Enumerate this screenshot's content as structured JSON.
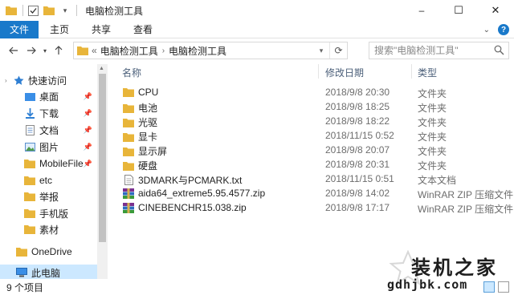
{
  "window": {
    "title": "电脑检测工具",
    "minimize_glyph": "–",
    "maximize_glyph": "☐",
    "close_glyph": "✕"
  },
  "ribbon": {
    "tabs": [
      "文件",
      "主页",
      "共享",
      "查看"
    ]
  },
  "address": {
    "segments": [
      "电脑检测工具",
      "电脑检测工具"
    ],
    "prefix": "«"
  },
  "search": {
    "placeholder": "搜索\"电脑检测工具\""
  },
  "nav": {
    "items": [
      {
        "label": "快速访问",
        "icon": "star-icon",
        "pinned": false,
        "indent": 0
      },
      {
        "label": "桌面",
        "icon": "desktop-folder-icon",
        "pinned": true,
        "indent": 1
      },
      {
        "label": "下载",
        "icon": "download-folder-icon",
        "pinned": true,
        "indent": 1
      },
      {
        "label": "文档",
        "icon": "document-folder-icon",
        "pinned": true,
        "indent": 1
      },
      {
        "label": "图片",
        "icon": "picture-folder-icon",
        "pinned": true,
        "indent": 1
      },
      {
        "label": "MobileFile",
        "icon": "folder-icon",
        "pinned": true,
        "indent": 1
      },
      {
        "label": "etc",
        "icon": "folder-icon",
        "pinned": false,
        "indent": 1
      },
      {
        "label": "举报",
        "icon": "folder-icon",
        "pinned": false,
        "indent": 1
      },
      {
        "label": "手机版",
        "icon": "folder-icon",
        "pinned": false,
        "indent": 1
      },
      {
        "label": "素材",
        "icon": "folder-icon",
        "pinned": false,
        "indent": 1
      },
      {
        "label": "OneDrive",
        "icon": "onedrive-icon",
        "pinned": false,
        "indent": 0
      },
      {
        "label": "此电脑",
        "icon": "this-pc-icon",
        "pinned": false,
        "indent": 0
      }
    ]
  },
  "columns": {
    "name": "名称",
    "date": "修改日期",
    "type": "类型"
  },
  "files": [
    {
      "name": "CPU",
      "date": "2018/9/8 20:30",
      "type": "文件夹",
      "icon": "folder-icon"
    },
    {
      "name": "电池",
      "date": "2018/9/8 18:25",
      "type": "文件夹",
      "icon": "folder-icon"
    },
    {
      "name": "光驱",
      "date": "2018/9/8 18:22",
      "type": "文件夹",
      "icon": "folder-icon"
    },
    {
      "name": "显卡",
      "date": "2018/11/15 0:52",
      "type": "文件夹",
      "icon": "folder-icon"
    },
    {
      "name": "显示屏",
      "date": "2018/9/8 20:07",
      "type": "文件夹",
      "icon": "folder-icon"
    },
    {
      "name": "硬盘",
      "date": "2018/9/8 20:31",
      "type": "文件夹",
      "icon": "folder-icon"
    },
    {
      "name": "3DMARK与PCMARK.txt",
      "date": "2018/11/15 0:51",
      "type": "文本文档",
      "icon": "text-file-icon"
    },
    {
      "name": "aida64_extreme5.95.4577.zip",
      "date": "2018/9/8 14:02",
      "type": "WinRAR ZIP 压缩文件",
      "icon": "zip-archive-icon"
    },
    {
      "name": "CINEBENCHR15.038.zip",
      "date": "2018/9/8 17:17",
      "type": "WinRAR ZIP 压缩文件",
      "icon": "zip-archive-icon"
    }
  ],
  "status": {
    "count": "9 个项目"
  },
  "watermark": {
    "title": "装机之家",
    "url": "gdhjbk.com"
  },
  "colors": {
    "accent": "#1979ca",
    "folder": "#e8b53a",
    "selected": "#cce8ff"
  }
}
